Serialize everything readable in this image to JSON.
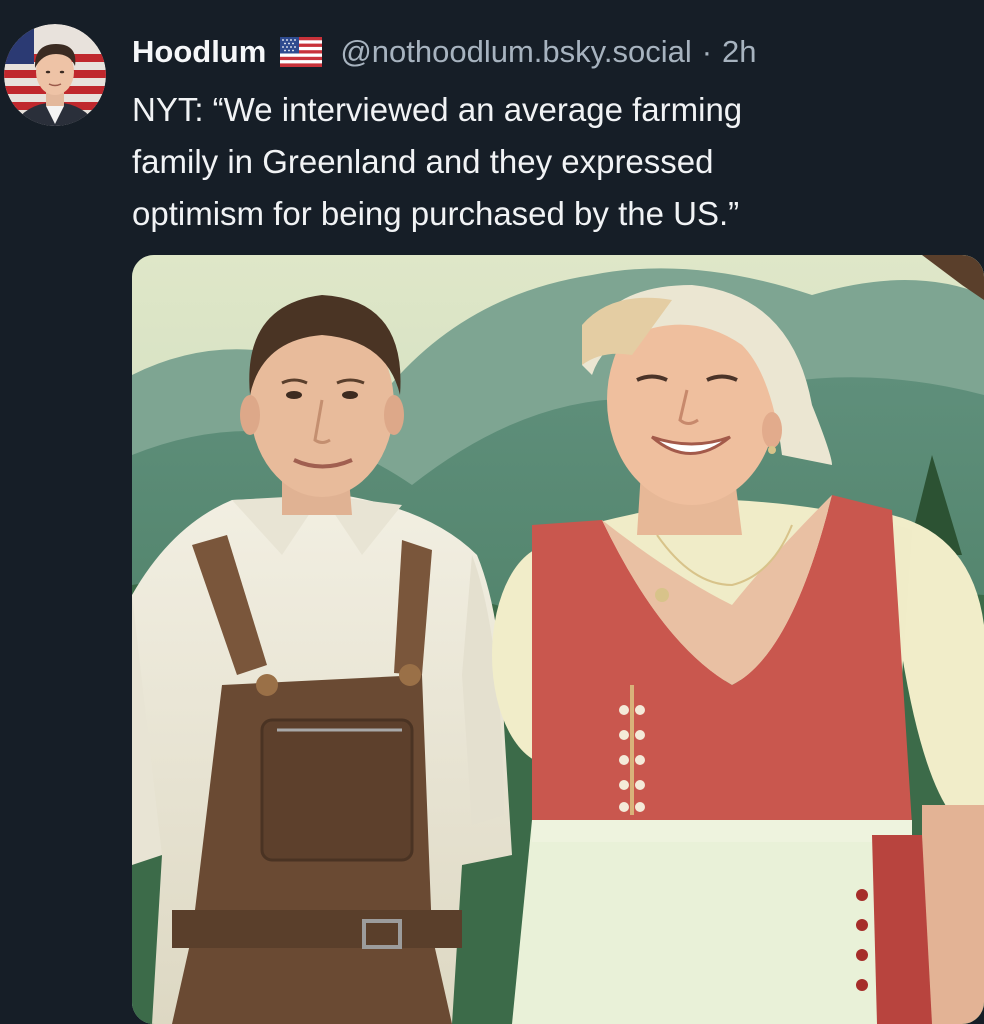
{
  "post": {
    "author": {
      "display_name": "Hoodlum",
      "flag_icon": "us-flag-icon",
      "handle": "@nothoodlum.bsky.social",
      "separator": "·",
      "timestamp": "2h"
    },
    "text": "NYT: “We interviewed an average farming\nfamily in Greenland and they expressed\noptimism for being purchased by the US.”",
    "media": {
      "type": "photo"
    }
  },
  "colors": {
    "background": "#161e27",
    "text_primary": "#f1f3f5",
    "text_secondary": "#a7b3bf"
  }
}
